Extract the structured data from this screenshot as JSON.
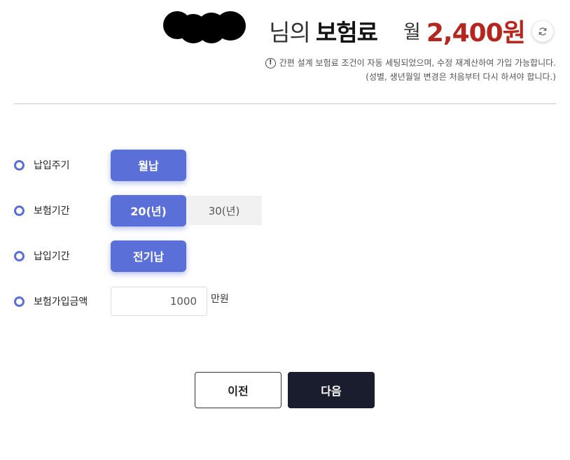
{
  "header": {
    "name_suffix": "님의",
    "title_strong": "보험료",
    "premium_period": "월",
    "premium_amount": "2,400원"
  },
  "notice": {
    "icon": "info-icon",
    "line1": "간편 설계 보험료 조건이 자동 세팅되었으며, 수정 재계산하여 가입 가능합니다.",
    "line2": "(성별, 생년월일 변경은 처음부터 다시 하셔야 합니다.)"
  },
  "form": {
    "payment_cycle": {
      "label": "납입주기",
      "options": [
        "월납"
      ],
      "selected": "월납"
    },
    "insurance_period": {
      "label": "보험기간",
      "options": [
        "20(년)",
        "30(년)"
      ],
      "selected": "20(년)"
    },
    "payment_period": {
      "label": "납입기간",
      "options": [
        "전기납"
      ],
      "selected": "전기납"
    },
    "coverage_amount": {
      "label": "보험가입금액",
      "value": "1000",
      "unit": "만원"
    }
  },
  "buttons": {
    "prev": "이전",
    "next": "다음"
  },
  "colors": {
    "accent": "#5a6fd8",
    "premium": "#b5261e",
    "next_button": "#191d2e"
  },
  "icons": [
    "refresh-icon",
    "info-icon",
    "radio-bullet"
  ]
}
